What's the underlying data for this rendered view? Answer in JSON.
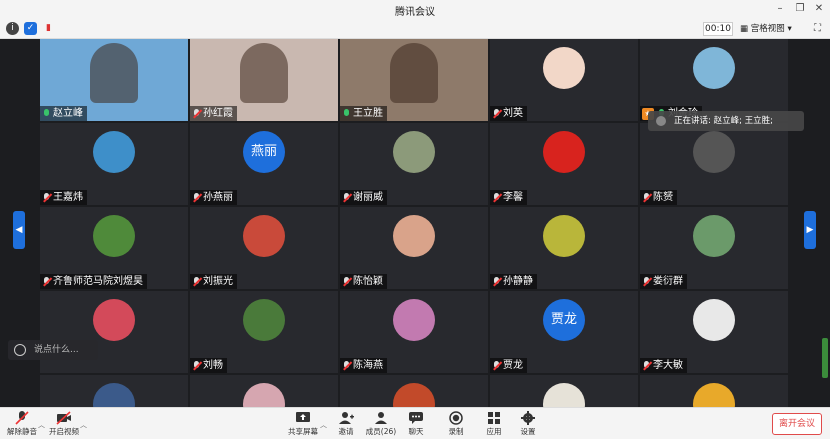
{
  "window": {
    "title": "腾讯会议"
  },
  "infobar": {
    "timer": "00:10",
    "view_label": "宫格视图"
  },
  "speaking_tip": "正在讲话: 赵立峰; 王立胜;",
  "chat_placeholder": "说点什么...",
  "colors": {
    "accent": "#1e6fdc",
    "leave": "#e04b4b",
    "host": "#f08a24"
  },
  "participants": [
    {
      "name": "赵立峰",
      "mic": "on",
      "kind": "video",
      "bg": "#6fa8d6"
    },
    {
      "name": "孙红霞",
      "mic": "off",
      "kind": "video",
      "bg": "#c9b8b0"
    },
    {
      "name": "王立胜",
      "mic": "on",
      "kind": "video",
      "bg": "#8e7a6a"
    },
    {
      "name": "刘英",
      "mic": "off",
      "kind": "avatar",
      "bg": "#f2d7c8"
    },
    {
      "name": "刘金玲",
      "mic": "on",
      "kind": "avatar",
      "bg": "#7fb6d8",
      "host": true
    },
    {
      "name": "王嘉炜",
      "mic": "off",
      "kind": "avatar",
      "bg": "#3e8fc9"
    },
    {
      "name": "孙燕丽",
      "mic": "off",
      "kind": "text",
      "avatar_text": "燕丽"
    },
    {
      "name": "谢丽威",
      "mic": "off",
      "kind": "avatar",
      "bg": "#8c9a7a"
    },
    {
      "name": "李馨",
      "mic": "off",
      "kind": "avatar",
      "bg": "#d8231e"
    },
    {
      "name": "陈赟",
      "mic": "off",
      "kind": "avatar",
      "bg": "#555555"
    },
    {
      "name": "齐鲁师范马院刘煜昊",
      "mic": "off",
      "kind": "avatar",
      "bg": "#4f8a3a"
    },
    {
      "name": "刘振光",
      "mic": "off",
      "kind": "avatar",
      "bg": "#c94a3a"
    },
    {
      "name": "陈怡颖",
      "mic": "off",
      "kind": "avatar",
      "bg": "#d9a38a"
    },
    {
      "name": "孙静静",
      "mic": "off",
      "kind": "avatar",
      "bg": "#b9b63a"
    },
    {
      "name": "娄衍群",
      "mic": "off",
      "kind": "avatar",
      "bg": "#6b9a6a"
    },
    {
      "name": "",
      "mic": "off",
      "kind": "avatar",
      "bg": "#d34a5a"
    },
    {
      "name": "刘畅",
      "mic": "off",
      "kind": "avatar",
      "bg": "#4a7a3a"
    },
    {
      "name": "陈海燕",
      "mic": "off",
      "kind": "avatar",
      "bg": "#c27ab0"
    },
    {
      "name": "贾龙",
      "mic": "off",
      "kind": "text",
      "avatar_text": "贾龙"
    },
    {
      "name": "李大敏",
      "mic": "off",
      "kind": "avatar",
      "bg": "#e8e8e8"
    },
    {
      "name": "",
      "mic": "off",
      "kind": "avatar",
      "bg": "#3b5a8a"
    },
    {
      "name": "",
      "mic": "off",
      "kind": "avatar",
      "bg": "#d6a6b0"
    },
    {
      "name": "",
      "mic": "off",
      "kind": "avatar",
      "bg": "#c24a2a"
    },
    {
      "name": "",
      "mic": "off",
      "kind": "avatar",
      "bg": "#e6e2d8"
    },
    {
      "name": "",
      "mic": "off",
      "kind": "avatar",
      "bg": "#e8a92a"
    }
  ],
  "toolbar": {
    "unmute": "解除静音",
    "video": "开启视频",
    "share": "共享屏幕",
    "invite": "邀请",
    "members": "成员(26)",
    "chat": "聊天",
    "record": "录制",
    "apps": "应用",
    "settings": "设置",
    "leave": "离开会议"
  }
}
